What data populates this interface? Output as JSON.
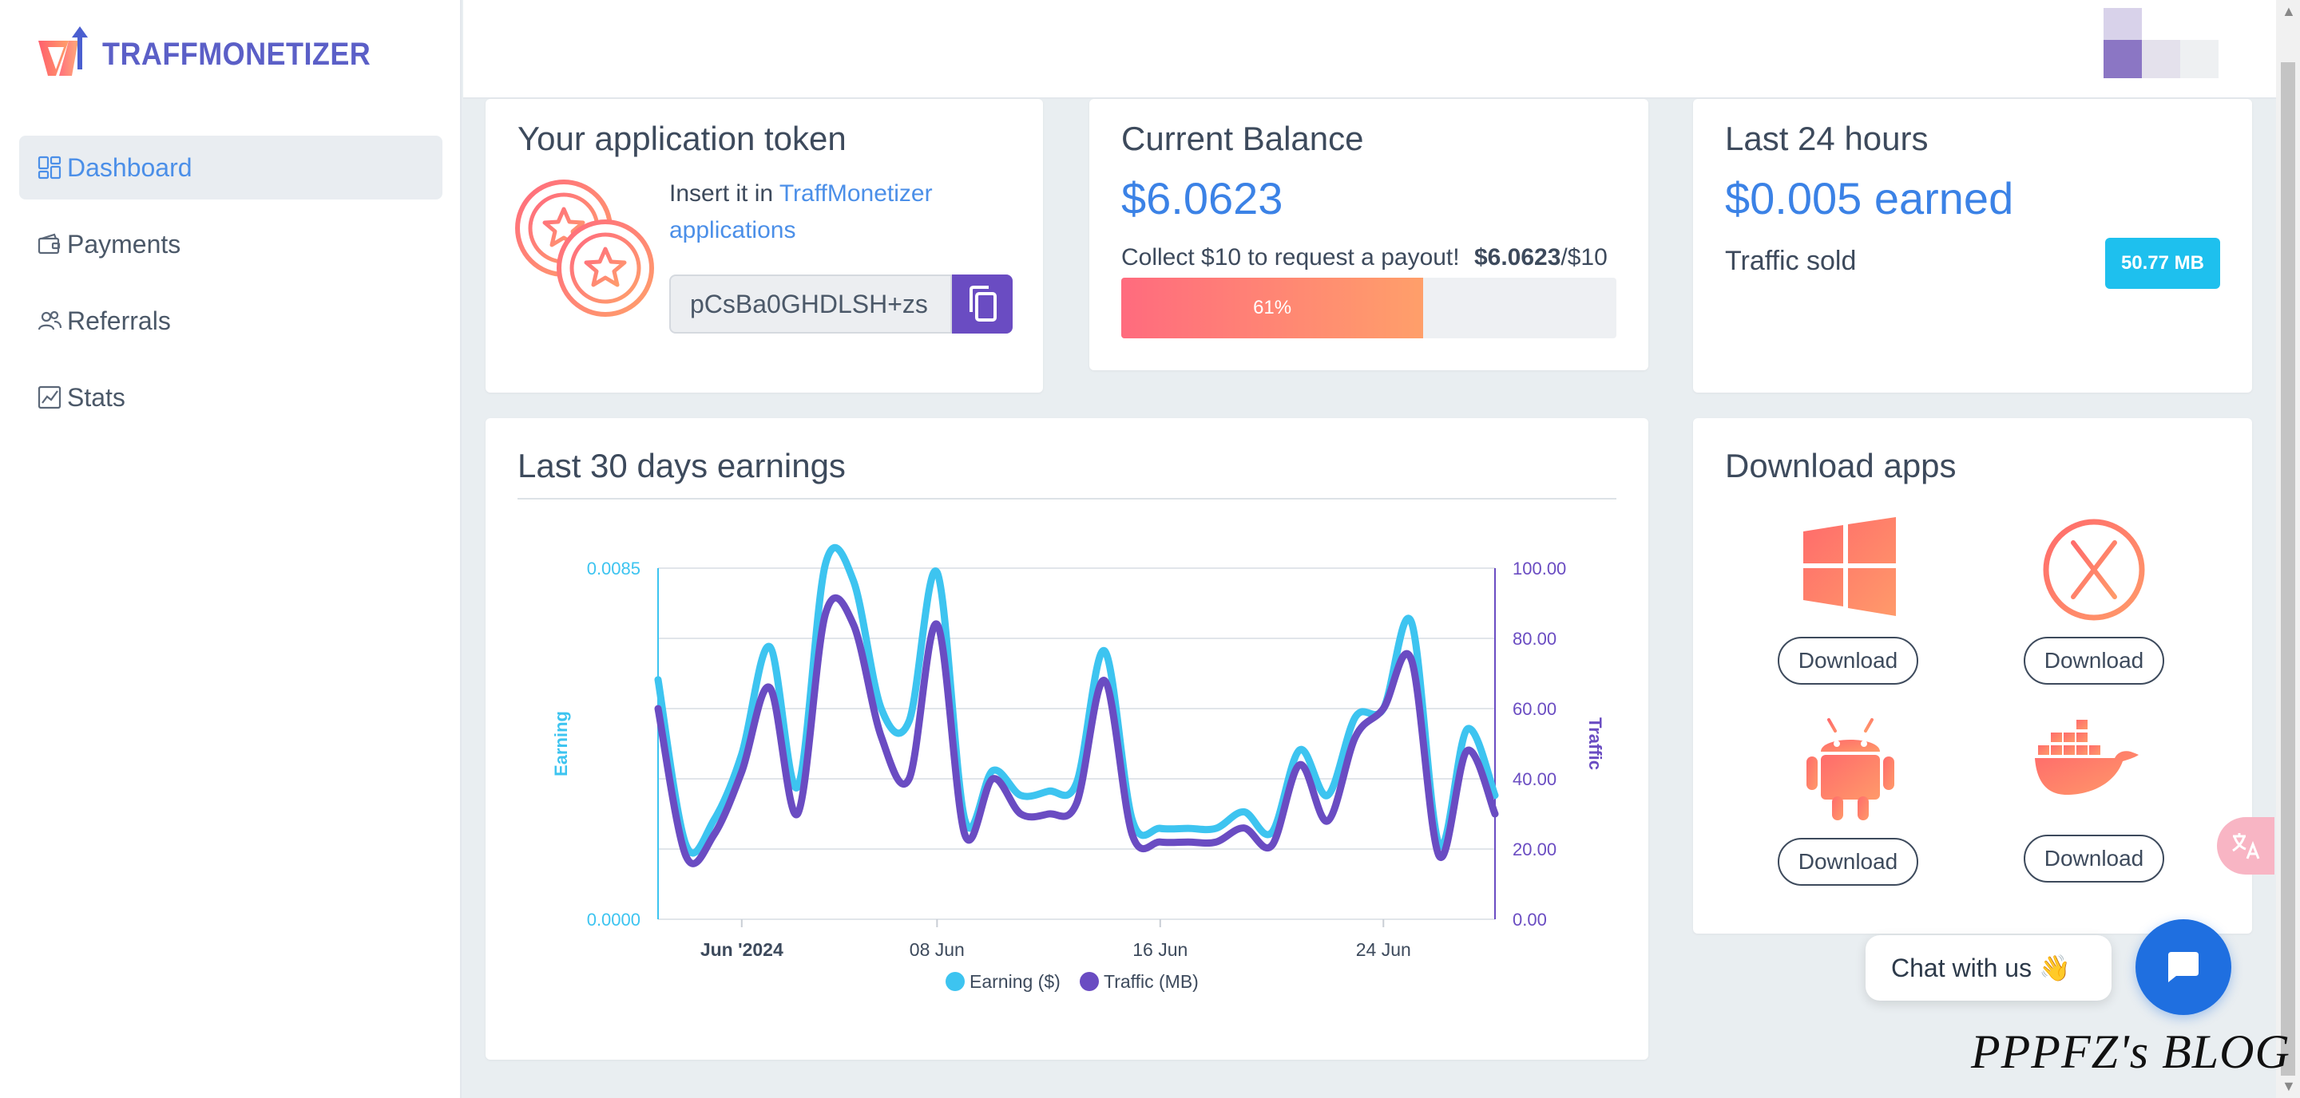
{
  "brand": {
    "name": "TRAFFMONETIZER"
  },
  "sidebar": {
    "items": [
      {
        "label": "Dashboard",
        "icon": "dashboard-icon",
        "active": true
      },
      {
        "label": "Payments",
        "icon": "wallet-icon",
        "active": false
      },
      {
        "label": "Referrals",
        "icon": "users-icon",
        "active": false
      },
      {
        "label": "Stats",
        "icon": "chart-icon",
        "active": false
      }
    ]
  },
  "token_card": {
    "title": "Your application token",
    "text_prefix": "Insert it in ",
    "text_link": "TraffMonetizer applications",
    "token_value": "pCsBa0GHDLSH+zs",
    "copy_icon": "copy-icon"
  },
  "balance_card": {
    "title": "Current Balance",
    "amount": "$6.0623",
    "payout_text": "Collect $10 to request a payout!",
    "payout_current": "$6.0623",
    "payout_target": "/$10",
    "progress_label": "61%",
    "progress_value": 0.61
  },
  "last24_card": {
    "title": "Last 24 hours",
    "earned": "$0.005 earned",
    "traffic_label": "Traffic sold",
    "traffic_value": "50.77 MB"
  },
  "chart_card": {
    "title": "Last 30 days earnings"
  },
  "chart_data": {
    "type": "line",
    "xlabel": "",
    "y_left_label": "Earning",
    "y_right_label": "Traffic",
    "y_left_ticks": [
      "0.0085",
      "0.0000"
    ],
    "y_left_range": [
      0,
      0.0085
    ],
    "y_right_ticks": [
      "100.00",
      "80.00",
      "60.00",
      "40.00",
      "20.00",
      "0.00"
    ],
    "y_right_range": [
      0,
      100
    ],
    "x_ticks": [
      {
        "label": "Jun '2024",
        "bold": true,
        "index": 3
      },
      {
        "label": "08 Jun",
        "index": 10
      },
      {
        "label": "16 Jun",
        "index": 18
      },
      {
        "label": "24 Jun",
        "index": 26
      }
    ],
    "x_count": 31,
    "legend_position": "bottom",
    "series": [
      {
        "name": "Earning ($)",
        "axis": "left",
        "color": "#3dc4f0",
        "values": [
          0.0058,
          0.0018,
          0.0024,
          0.004,
          0.0066,
          0.0032,
          0.0086,
          0.0082,
          0.0051,
          0.0048,
          0.0084,
          0.0024,
          0.0036,
          0.003,
          0.0031,
          0.0033,
          0.0065,
          0.0024,
          0.0022,
          0.0022,
          0.0022,
          0.0026,
          0.0021,
          0.0041,
          0.003,
          0.0049,
          0.0051,
          0.0072,
          0.0018,
          0.0046,
          0.003
        ]
      },
      {
        "name": "Traffic (MB)",
        "axis": "right",
        "color": "#6a4cc2",
        "values": [
          60,
          18,
          24,
          42,
          66,
          30,
          87,
          84,
          52,
          40,
          84,
          24,
          40,
          30,
          30,
          33,
          68,
          24,
          22,
          22,
          22,
          26,
          21,
          44,
          28,
          52,
          60,
          74,
          18,
          48,
          30
        ]
      }
    ]
  },
  "download_card": {
    "title": "Download apps",
    "apps": [
      {
        "icon": "windows-icon",
        "button": "Download"
      },
      {
        "icon": "macos-icon",
        "button": "Download"
      },
      {
        "icon": "android-icon",
        "button": "Download"
      },
      {
        "icon": "docker-icon",
        "button": "Download"
      }
    ]
  },
  "chat": {
    "label": "Chat with us 👋"
  },
  "watermark": "PPPFZ's BLOG",
  "colors": {
    "accent": "#3b82e6",
    "purple": "#6a4cc2",
    "cyan": "#3dc4f0",
    "coral": "#ff6b6b"
  }
}
